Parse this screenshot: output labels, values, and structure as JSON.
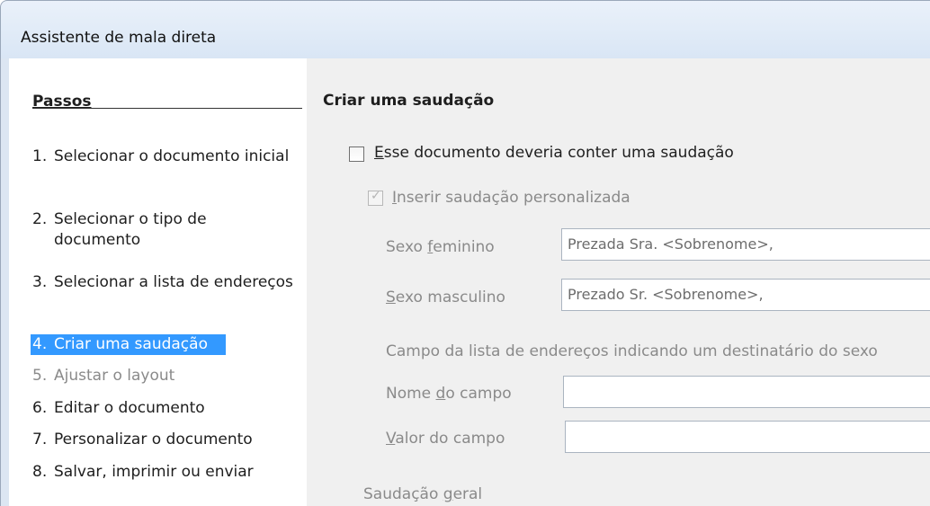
{
  "window": {
    "title": "Assistente de mala direta"
  },
  "sidebar": {
    "title": "Passos",
    "items": [
      {
        "num": "1.",
        "label": "Selecionar o documento inicial"
      },
      {
        "num": "2.",
        "label": "Selecionar o tipo de documento"
      },
      {
        "num": "3.",
        "label": "Selecionar a lista de endereços"
      },
      {
        "num": "4.",
        "label": "Criar uma saudação"
      },
      {
        "num": "5.",
        "label": "Ajustar o layout"
      },
      {
        "num": "6.",
        "label": "Editar o documento"
      },
      {
        "num": "7.",
        "label": "Personalizar o documento"
      },
      {
        "num": "8.",
        "label": "Salvar, imprimir ou enviar"
      }
    ]
  },
  "main": {
    "heading": "Criar uma saudação",
    "salutation_checkbox": {
      "label_first": "E",
      "label_rest": "sse documento deveria conter uma saudação",
      "checked": false
    },
    "custom_checkbox": {
      "label_first": "I",
      "label_rest": "nserir saudação personalizada",
      "checked": true
    },
    "female": {
      "label_pre": "Sexo ",
      "label_key": "f",
      "label_post": "eminino",
      "value": "Prezada Sra. <Sobrenome>,"
    },
    "male": {
      "label_key": "S",
      "label_post": "exo masculino",
      "value": "Prezado Sr. <Sobrenome>,"
    },
    "address_field_text": "Campo da lista de endereços indicando um destinatário do sexo",
    "field_name": {
      "label_pre": "Nome ",
      "label_key": "d",
      "label_post": "o campo",
      "value": ""
    },
    "field_value": {
      "label_key": "V",
      "label_post": "alor do campo",
      "value": ""
    },
    "general": {
      "label_pre": "Saudação ",
      "label_key": "g",
      "label_post": "eral"
    }
  }
}
